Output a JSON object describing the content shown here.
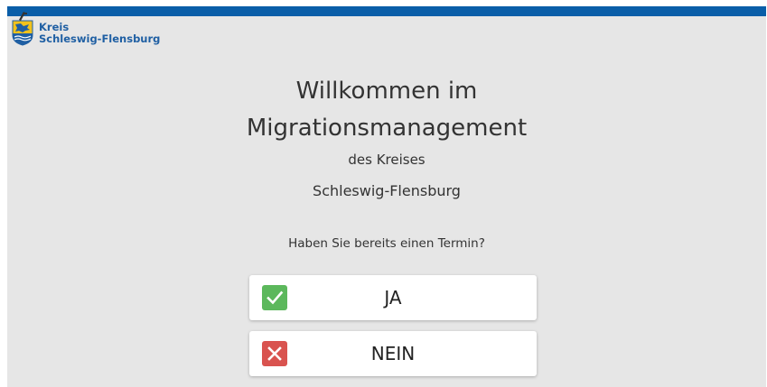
{
  "header": {
    "logo_line1": "Kreis",
    "logo_line2": "Schleswig-Flensburg",
    "bar_color": "#0a5ea8"
  },
  "main": {
    "title_line1": "Willkommen im",
    "title_line2": "Migrationsmanagement",
    "subtitle_line1": "des Kreises",
    "subtitle_line2": "Schleswig-Flensburg",
    "question": "Haben Sie bereits einen Termin?"
  },
  "choices": {
    "yes": {
      "label": "JA",
      "icon": "checkmark-icon",
      "color": "#5cb85c"
    },
    "no": {
      "label": "NEIN",
      "icon": "x-icon",
      "color": "#d9534f"
    }
  }
}
